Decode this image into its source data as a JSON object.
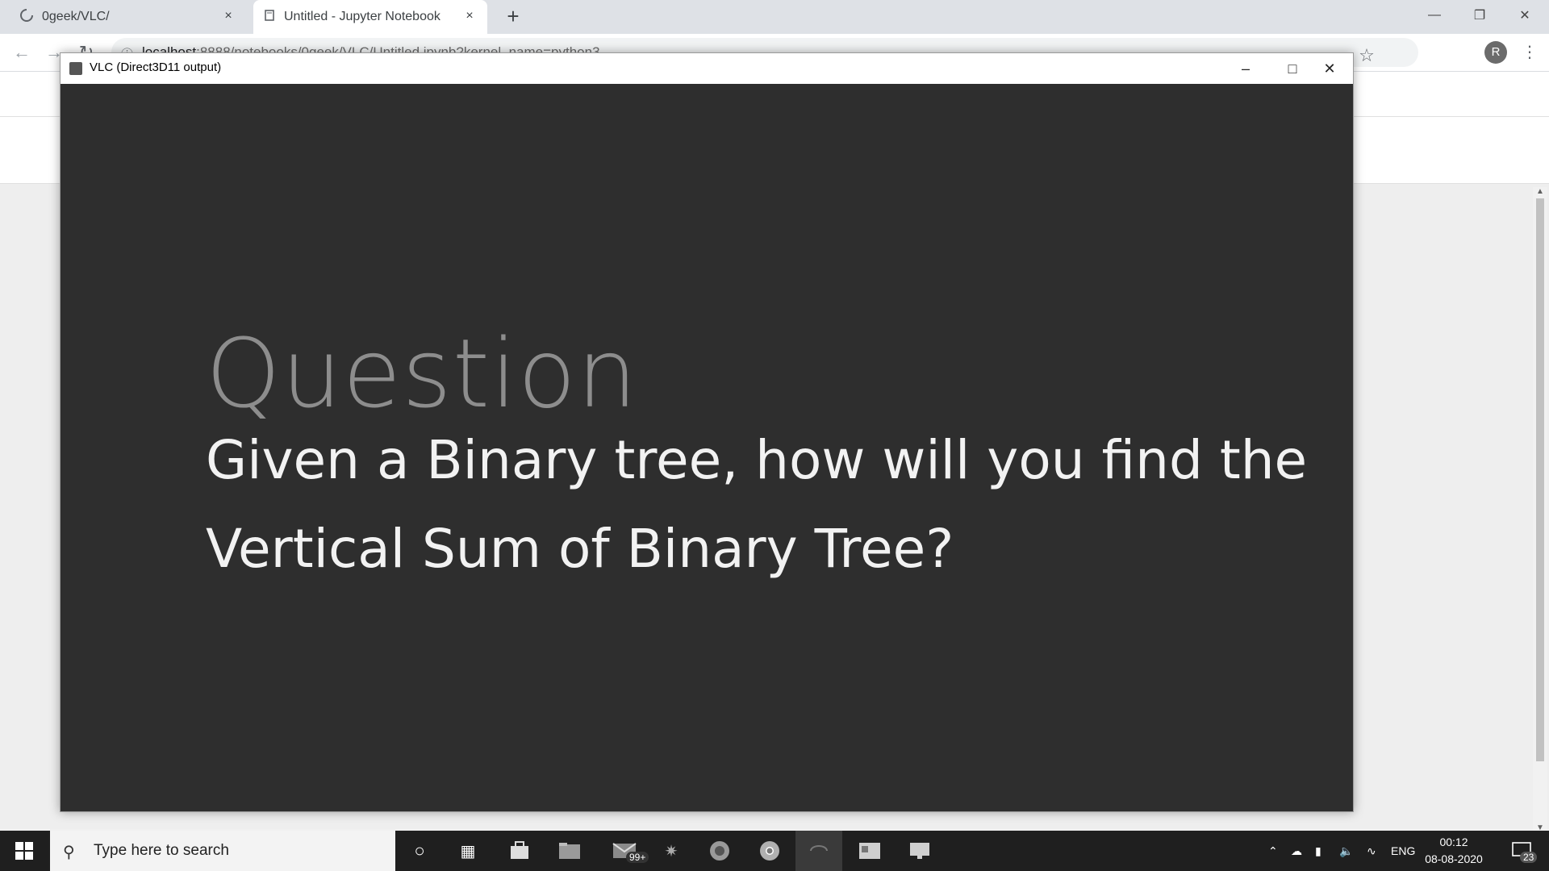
{
  "browser": {
    "tabs": [
      {
        "label": "0geek/VLC/",
        "close": "×"
      },
      {
        "label": "Untitled - Jupyter Notebook",
        "close": "×"
      }
    ],
    "new_tab": "+",
    "url_host": "localhost",
    "url_path": ":8888/notebooks/0geek/VLC/Untitled.ipynb?kernel_name=python3",
    "profile_initial": "R"
  },
  "vlc": {
    "title": "VLC (Direct3D11 output)",
    "video": {
      "heading": "Question",
      "line1": "Given a Binary tree, how will you find the",
      "line2": "Vertical Sum of Binary Tree?"
    }
  },
  "taskbar": {
    "search_placeholder": "Type here to search",
    "mail_badge": "99+",
    "language": "ENG",
    "time": "00:12",
    "date": "08-08-2020",
    "notifications": "23"
  },
  "colors": {
    "video_bg": "#2e2e2e",
    "heading": "#8d8d8d",
    "text": "#f2f2f2"
  }
}
